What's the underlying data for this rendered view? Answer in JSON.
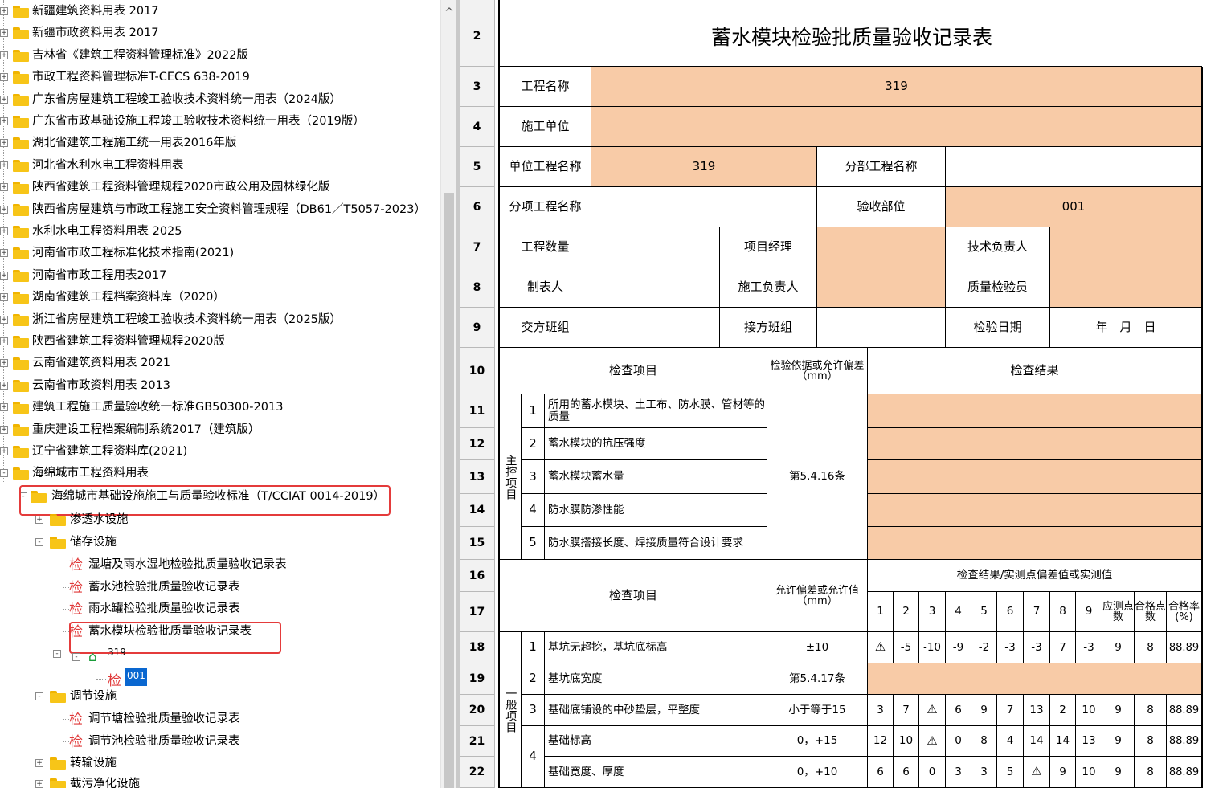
{
  "tree": {
    "items": [
      {
        "label": "新疆建筑资料用表 2017",
        "expander": "+"
      },
      {
        "label": "新疆市政资料用表 2017",
        "expander": "+"
      },
      {
        "label": "吉林省《建筑工程资料管理标准》2022版",
        "expander": "+"
      },
      {
        "label": "市政工程资料管理标准T-CECS 638-2019",
        "expander": "+"
      },
      {
        "label": "广东省房屋建筑工程竣工验收技术资料统一用表（2024版）",
        "expander": "+"
      },
      {
        "label": "广东省市政基础设施工程竣工验收技术资料统一用表（2019版）",
        "expander": "+"
      },
      {
        "label": "湖北省建筑工程施工统一用表2016年版",
        "expander": "+"
      },
      {
        "label": "河北省水利水电工程资料用表",
        "expander": "+"
      },
      {
        "label": "陕西省建筑工程资料管理规程2020市政公用及园林绿化版",
        "expander": "+"
      },
      {
        "label": "陕西省房屋建筑与市政工程施工安全资料管理规程（DB61／T5057-2023）",
        "expander": "+"
      },
      {
        "label": "水利水电工程资料用表 2025",
        "expander": "+"
      },
      {
        "label": "河南省市政工程标准化技术指南(2021)",
        "expander": "+"
      },
      {
        "label": "河南省市政工程用表2017",
        "expander": "+"
      },
      {
        "label": "湖南省建筑工程档案资料库（2020）",
        "expander": "+"
      },
      {
        "label": "浙江省房屋建筑工程竣工验收技术资料统一用表（2025版）",
        "expander": "+"
      },
      {
        "label": "陕西省建筑工程资料管理规程2020版",
        "expander": "+"
      },
      {
        "label": "云南省建筑资料用表 2021",
        "expander": "+"
      },
      {
        "label": "云南省市政资料用表 2013",
        "expander": "+"
      },
      {
        "label": "建筑工程施工质量验收统一标准GB50300-2013",
        "expander": "+"
      },
      {
        "label": "重庆建设工程档案编制系统2017（建筑版）",
        "expander": "+"
      },
      {
        "label": "辽宁省建筑工程资料库(2021)",
        "expander": "+"
      },
      {
        "label": "海绵城市工程资料用表",
        "expander": "-"
      }
    ],
    "standard": "海绵城市基础设施施工与质量验收标准（T/CCIAT 0014-2019）",
    "infiltration": "渗透水设施",
    "storage": "储存设施",
    "storage_children": [
      "湿塘及雨水湿地检验批质量验收记录表",
      "蓄水池检验批质量验收记录表",
      "雨水罐检验批质量验收记录表",
      "蓄水模块检验批质量验收记录表"
    ],
    "project": "319",
    "selected": "001",
    "regulation": "调节设施",
    "regulation_children": [
      "调节塘检验批质量验收记录表",
      "调节池检验批质量验收记录表"
    ],
    "transport": "转输设施",
    "interception": "截污净化设施",
    "jian_glyph": "检",
    "expander_plus": "+",
    "expander_minus": "-"
  },
  "scroll": {
    "up_arrow": "^"
  },
  "sheet": {
    "title": "蓄水模块检验批质量验收记录表",
    "row_numbers": [
      "2",
      "3",
      "4",
      "5",
      "6",
      "7",
      "8",
      "9",
      "10",
      "11",
      "12",
      "13",
      "14",
      "15",
      "16",
      "17",
      "18",
      "19",
      "20",
      "21",
      "22"
    ],
    "labels": {
      "project_name": "工程名称",
      "project_name_val": "319",
      "construction_unit": "施工单位",
      "unit_project": "单位工程名称",
      "unit_project_val": "319",
      "division_project": "分部工程名称",
      "subitem_project": "分项工程名称",
      "inspection_part": "验收部位",
      "inspection_part_val": "001",
      "quantity": "工程数量",
      "pm": "项目经理",
      "tech_lead": "技术负责人",
      "tabulator": "制表人",
      "construction_lead": "施工负责人",
      "quality_inspector": "质量检验员",
      "handover_shift": "交方班组",
      "takeover_shift": "接方班组",
      "inspection_date": "检验日期",
      "date_val": "年　月　日",
      "check_item": "检查项目",
      "basis": "检验依据或允许偏差（mm）",
      "check_result": "检查结果",
      "main_control": "主控项目",
      "clause_main": "第5.4.16条",
      "result_header": "检查结果/实测点偏差值或实测值",
      "allow_dev": "允许偏差或允许值（mm）",
      "should_pts": "应测点数",
      "pass_pts": "合格点数",
      "pass_rate": "合格率(%)",
      "general": "一般项目"
    },
    "main_items": [
      {
        "no": "1",
        "text": "所用的蓄水模块、土工布、防水膜、管材等的质量"
      },
      {
        "no": "2",
        "text": "蓄水模块的抗压强度"
      },
      {
        "no": "3",
        "text": "蓄水模块蓄水量"
      },
      {
        "no": "4",
        "text": "防水膜防渗性能"
      },
      {
        "no": "5",
        "text": "防水膜搭接长度、焊接质量符合设计要求"
      }
    ],
    "point_numbers": [
      "1",
      "2",
      "3",
      "4",
      "5",
      "6",
      "7",
      "8",
      "9"
    ],
    "general_items": [
      {
        "no": "1",
        "text": "基坑无超挖，基坑底标高",
        "tol": "±10",
        "pts": [
          "⚠",
          "-5",
          "-10",
          "-9",
          "-2",
          "-3",
          "-3",
          "7",
          "-3"
        ],
        "should": "9",
        "pass": "8",
        "rate": "88.89"
      },
      {
        "no": "2",
        "text": "基坑底宽度",
        "tol": "第5.4.17条",
        "pts": [],
        "should": "",
        "pass": "",
        "rate": ""
      },
      {
        "no": "3",
        "text": "基础底铺设的中砂垫层，平整度",
        "tol": "小于等于15",
        "pts": [
          "3",
          "7",
          "⚠",
          "6",
          "9",
          "7",
          "13",
          "2",
          "10"
        ],
        "should": "9",
        "pass": "8",
        "rate": "88.89"
      },
      {
        "no": "4",
        "text": "基础标高",
        "tol": "0，+15",
        "pts": [
          "12",
          "10",
          "⚠",
          "0",
          "8",
          "4",
          "14",
          "14",
          "13"
        ],
        "should": "9",
        "pass": "8",
        "rate": "88.89"
      },
      {
        "no": "",
        "text": "基础宽度、厚度",
        "tol": "0，+10",
        "pts": [
          "6",
          "6",
          "0",
          "3",
          "3",
          "5",
          "⚠",
          "9",
          "10"
        ],
        "should": "9",
        "pass": "8",
        "rate": "88.89"
      }
    ],
    "colors": {
      "peach": "#f8cba7",
      "highlight": "#e43b3b",
      "selection": "#0a67d0"
    }
  }
}
